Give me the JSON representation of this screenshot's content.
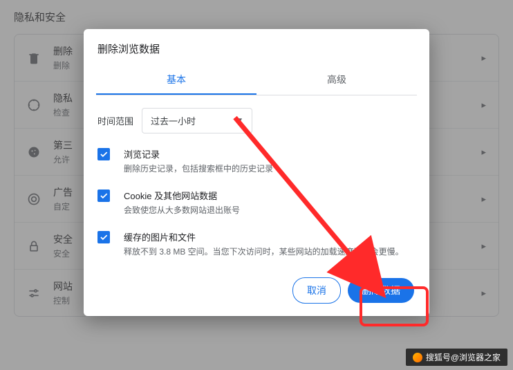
{
  "pageTitle": "隐私和安全",
  "settings": [
    {
      "title": "删除",
      "sub": "删除"
    },
    {
      "title": "隐私",
      "sub": "检查"
    },
    {
      "title": "第三",
      "sub": "允许"
    },
    {
      "title": "广告",
      "sub": "自定"
    },
    {
      "title": "安全",
      "sub": "安全"
    },
    {
      "title": "网站",
      "sub": "控制"
    }
  ],
  "dialog": {
    "title": "删除浏览数据",
    "tabs": {
      "basic": "基本",
      "advanced": "高级"
    },
    "timeLabel": "时间范围",
    "timeValue": "过去一小时",
    "items": [
      {
        "title": "浏览记录",
        "sub": "删除历史记录，包括搜索框中的历史记录"
      },
      {
        "title": "Cookie 及其他网站数据",
        "sub": "会致使您从大多数网站退出账号"
      },
      {
        "title": "缓存的图片和文件",
        "sub": "释放不到 3.8 MB 空间。当您下次访问时，某些网站的加载速度可能会更慢。"
      }
    ],
    "cancel": "取消",
    "confirm": "删除数据"
  },
  "watermark": "搜狐号@浏览器之家"
}
